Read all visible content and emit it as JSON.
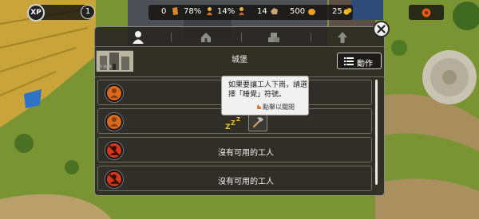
{
  "hud": {
    "xp_label": "XP",
    "level": "1",
    "resources": [
      {
        "name": "wood",
        "icon": "wood-icon",
        "value": "0"
      },
      {
        "name": "happiness",
        "icon": "villager-icon",
        "value": "78%"
      },
      {
        "name": "tax",
        "icon": "villager-icon",
        "value": "14%"
      },
      {
        "name": "stone",
        "icon": "stone-icon",
        "value": "14"
      },
      {
        "name": "food",
        "icon": "food-icon",
        "value": "500"
      },
      {
        "name": "gold",
        "icon": "gold-icon",
        "value": "25"
      }
    ]
  },
  "dialog": {
    "tabs": [
      {
        "name": "workers",
        "icon": "person-icon",
        "active": true
      },
      {
        "name": "house",
        "icon": "house-icon",
        "active": false
      },
      {
        "name": "storage",
        "icon": "crate-icon",
        "active": false
      },
      {
        "name": "upgrade",
        "icon": "arrow-up-icon",
        "active": false
      }
    ],
    "building_title": "城堡",
    "action_label": "動作",
    "rows": [
      {
        "type": "worker",
        "text": ""
      },
      {
        "type": "worker",
        "text": ""
      },
      {
        "type": "empty",
        "text": "沒有可用的工人"
      },
      {
        "type": "empty",
        "text": "沒有可用的工人"
      }
    ],
    "tooltip": {
      "text": "如果要讓工人下崗，請選擇「睡覺」符號。",
      "close_hint": "點擊以關閉"
    }
  },
  "colors": {
    "panel": "#2c2a26",
    "panel_border": "#8a8a86",
    "worker_orange": "#e0701e",
    "unavailable_red": "#d2381e",
    "sleep_yellow": "#e6c21e"
  }
}
